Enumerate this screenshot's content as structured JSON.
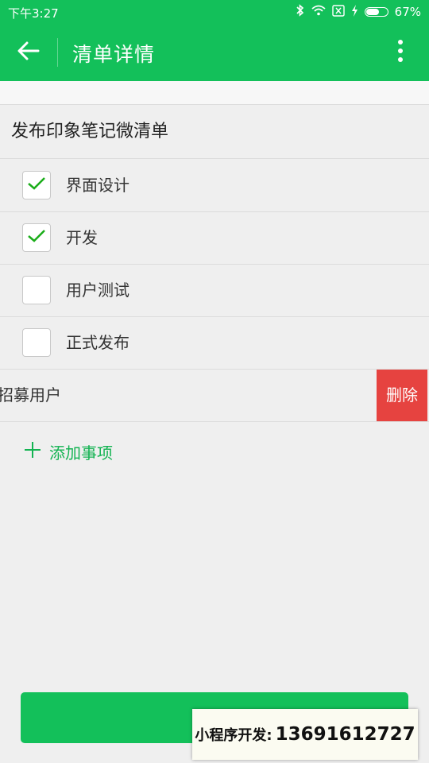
{
  "status_bar": {
    "time": "下午3:27",
    "battery": "67%",
    "battery_level": 0.67
  },
  "app_bar": {
    "title": "清单详情"
  },
  "list": {
    "title": "发布印象笔记微清单",
    "items": [
      {
        "label": "界面设计",
        "checked": true
      },
      {
        "label": "开发",
        "checked": true
      },
      {
        "label": "用户测试",
        "checked": false
      },
      {
        "label": "正式发布",
        "checked": false
      }
    ],
    "swiped_item": {
      "label": "招募用户",
      "delete_label": "删除"
    },
    "add_label": "添加事项"
  },
  "overlay": {
    "label": "小程序开发:",
    "phone": "13691612727"
  },
  "colors": {
    "primary": "#13c05a",
    "danger": "#e64340",
    "check": "#1aad19"
  }
}
